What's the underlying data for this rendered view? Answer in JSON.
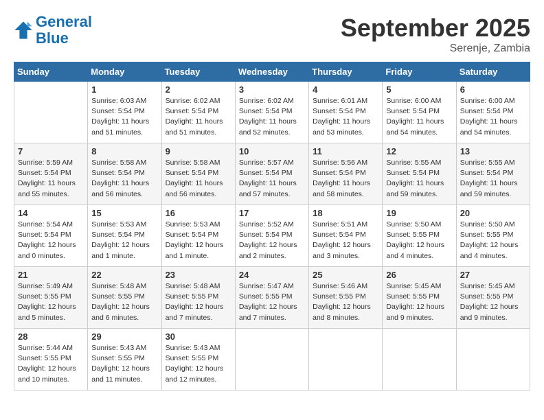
{
  "logo": {
    "line1": "General",
    "line2": "Blue"
  },
  "title": "September 2025",
  "location": "Serenje, Zambia",
  "days_of_week": [
    "Sunday",
    "Monday",
    "Tuesday",
    "Wednesday",
    "Thursday",
    "Friday",
    "Saturday"
  ],
  "weeks": [
    [
      {
        "day": "",
        "info": ""
      },
      {
        "day": "1",
        "info": "Sunrise: 6:03 AM\nSunset: 5:54 PM\nDaylight: 11 hours\nand 51 minutes."
      },
      {
        "day": "2",
        "info": "Sunrise: 6:02 AM\nSunset: 5:54 PM\nDaylight: 11 hours\nand 51 minutes."
      },
      {
        "day": "3",
        "info": "Sunrise: 6:02 AM\nSunset: 5:54 PM\nDaylight: 11 hours\nand 52 minutes."
      },
      {
        "day": "4",
        "info": "Sunrise: 6:01 AM\nSunset: 5:54 PM\nDaylight: 11 hours\nand 53 minutes."
      },
      {
        "day": "5",
        "info": "Sunrise: 6:00 AM\nSunset: 5:54 PM\nDaylight: 11 hours\nand 54 minutes."
      },
      {
        "day": "6",
        "info": "Sunrise: 6:00 AM\nSunset: 5:54 PM\nDaylight: 11 hours\nand 54 minutes."
      }
    ],
    [
      {
        "day": "7",
        "info": "Sunrise: 5:59 AM\nSunset: 5:54 PM\nDaylight: 11 hours\nand 55 minutes."
      },
      {
        "day": "8",
        "info": "Sunrise: 5:58 AM\nSunset: 5:54 PM\nDaylight: 11 hours\nand 56 minutes."
      },
      {
        "day": "9",
        "info": "Sunrise: 5:58 AM\nSunset: 5:54 PM\nDaylight: 11 hours\nand 56 minutes."
      },
      {
        "day": "10",
        "info": "Sunrise: 5:57 AM\nSunset: 5:54 PM\nDaylight: 11 hours\nand 57 minutes."
      },
      {
        "day": "11",
        "info": "Sunrise: 5:56 AM\nSunset: 5:54 PM\nDaylight: 11 hours\nand 58 minutes."
      },
      {
        "day": "12",
        "info": "Sunrise: 5:55 AM\nSunset: 5:54 PM\nDaylight: 11 hours\nand 59 minutes."
      },
      {
        "day": "13",
        "info": "Sunrise: 5:55 AM\nSunset: 5:54 PM\nDaylight: 11 hours\nand 59 minutes."
      }
    ],
    [
      {
        "day": "14",
        "info": "Sunrise: 5:54 AM\nSunset: 5:54 PM\nDaylight: 12 hours\nand 0 minutes."
      },
      {
        "day": "15",
        "info": "Sunrise: 5:53 AM\nSunset: 5:54 PM\nDaylight: 12 hours\nand 1 minute."
      },
      {
        "day": "16",
        "info": "Sunrise: 5:53 AM\nSunset: 5:54 PM\nDaylight: 12 hours\nand 1 minute."
      },
      {
        "day": "17",
        "info": "Sunrise: 5:52 AM\nSunset: 5:54 PM\nDaylight: 12 hours\nand 2 minutes."
      },
      {
        "day": "18",
        "info": "Sunrise: 5:51 AM\nSunset: 5:54 PM\nDaylight: 12 hours\nand 3 minutes."
      },
      {
        "day": "19",
        "info": "Sunrise: 5:50 AM\nSunset: 5:55 PM\nDaylight: 12 hours\nand 4 minutes."
      },
      {
        "day": "20",
        "info": "Sunrise: 5:50 AM\nSunset: 5:55 PM\nDaylight: 12 hours\nand 4 minutes."
      }
    ],
    [
      {
        "day": "21",
        "info": "Sunrise: 5:49 AM\nSunset: 5:55 PM\nDaylight: 12 hours\nand 5 minutes."
      },
      {
        "day": "22",
        "info": "Sunrise: 5:48 AM\nSunset: 5:55 PM\nDaylight: 12 hours\nand 6 minutes."
      },
      {
        "day": "23",
        "info": "Sunrise: 5:48 AM\nSunset: 5:55 PM\nDaylight: 12 hours\nand 7 minutes."
      },
      {
        "day": "24",
        "info": "Sunrise: 5:47 AM\nSunset: 5:55 PM\nDaylight: 12 hours\nand 7 minutes."
      },
      {
        "day": "25",
        "info": "Sunrise: 5:46 AM\nSunset: 5:55 PM\nDaylight: 12 hours\nand 8 minutes."
      },
      {
        "day": "26",
        "info": "Sunrise: 5:45 AM\nSunset: 5:55 PM\nDaylight: 12 hours\nand 9 minutes."
      },
      {
        "day": "27",
        "info": "Sunrise: 5:45 AM\nSunset: 5:55 PM\nDaylight: 12 hours\nand 9 minutes."
      }
    ],
    [
      {
        "day": "28",
        "info": "Sunrise: 5:44 AM\nSunset: 5:55 PM\nDaylight: 12 hours\nand 10 minutes."
      },
      {
        "day": "29",
        "info": "Sunrise: 5:43 AM\nSunset: 5:55 PM\nDaylight: 12 hours\nand 11 minutes."
      },
      {
        "day": "30",
        "info": "Sunrise: 5:43 AM\nSunset: 5:55 PM\nDaylight: 12 hours\nand 12 minutes."
      },
      {
        "day": "",
        "info": ""
      },
      {
        "day": "",
        "info": ""
      },
      {
        "day": "",
        "info": ""
      },
      {
        "day": "",
        "info": ""
      }
    ]
  ]
}
